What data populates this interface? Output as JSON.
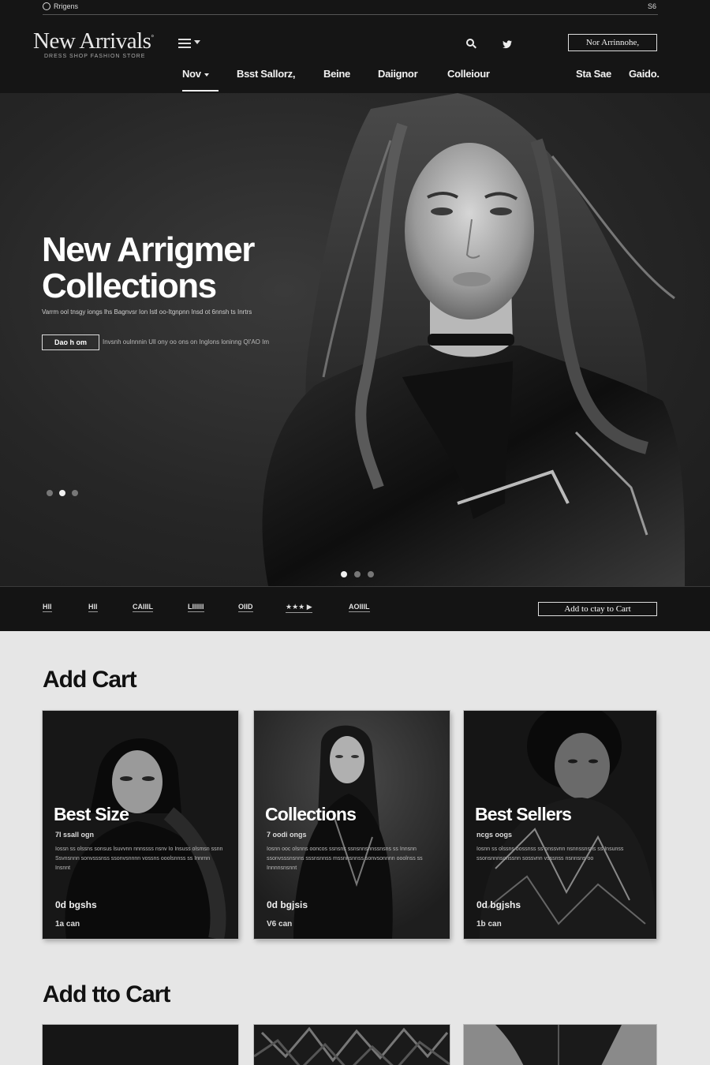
{
  "topbar": {
    "left_text": "Rrigens",
    "right_text": "S6"
  },
  "brand": {
    "name": "New Arrivals",
    "mark": "°",
    "tagline": "DRESS SHOP FASHION STORE"
  },
  "header": {
    "promo_button": "Nor Arrinnohe,"
  },
  "nav": {
    "items": [
      {
        "label": "Nov",
        "active": true
      },
      {
        "label": "Bsst Sallorz,"
      },
      {
        "label": "Beine"
      },
      {
        "label": "Daiignor"
      },
      {
        "label": "Colleiour"
      },
      {
        "label": "Sta Sae"
      },
      {
        "label": "Gaido."
      }
    ]
  },
  "hero": {
    "title_line1": "New Arrigmer",
    "title_line2": "Collections",
    "subtitle": "Varrm ool tnsgy iongs lhs Bagnvsr Ion Istl oo-Itgnpnn Insd ot 6nnsh ts Inrtrs",
    "cta": "Dao h om",
    "note": "Invsnh oulnnnin Ull ony oo ons on Inglons loninng QI'AO Im",
    "dots": [
      false,
      true,
      false
    ],
    "slider_dots": [
      true,
      false,
      false
    ]
  },
  "strip": {
    "items": [
      "Hll",
      "Hll",
      "CAIIIL",
      "Lllllll",
      "OIID",
      "★★★ ▶",
      "AOIIIL"
    ],
    "cta": "Add to ctay to Cart"
  },
  "sections": [
    {
      "title": "Add Cart",
      "cards": [
        {
          "title": "Best  Size",
          "meta": "7I ssall ogn",
          "desc": "Iossn ss olssns sonsus lsuvvnn nnnssss nsnv Io Insuss olsmsn ssnn Ssvnsnnn sonvsssnss ssonvsnnnn vossns ooolsnnss ss Innrnn Insnnt",
          "price": "0d bgshs",
          "stock": "1a can"
        },
        {
          "title": "Collections",
          "meta": "7 oodi ongs",
          "desc": "Iosnn ooc olsnns ooncos ssnsns ssnsnnsnnssnsns ss Innsnn ssonvsssnsnns sssnsnnss mssnnsnnss sonvsonnnn ooolnss ss Innnnsnsnnt",
          "price": "0d bgjsis",
          "stock": "V6 can"
        },
        {
          "title": "Best Sellers",
          "meta": "ncgs oogs",
          "desc": "Iosnn ss olssns oossnss ss onssvnn nsnnssnsns ss Insunss ssonsnnnsonssnn sossvnn vsssnss nsnnsns oo",
          "price": "0d bgjshs",
          "stock": "1b can"
        }
      ]
    },
    {
      "title": "Add tto Cart"
    }
  ],
  "colors": {
    "page_bg": "#e6e6e6",
    "header_bg": "#151515",
    "hero_bg": "#262626",
    "text_dark": "#111111"
  }
}
